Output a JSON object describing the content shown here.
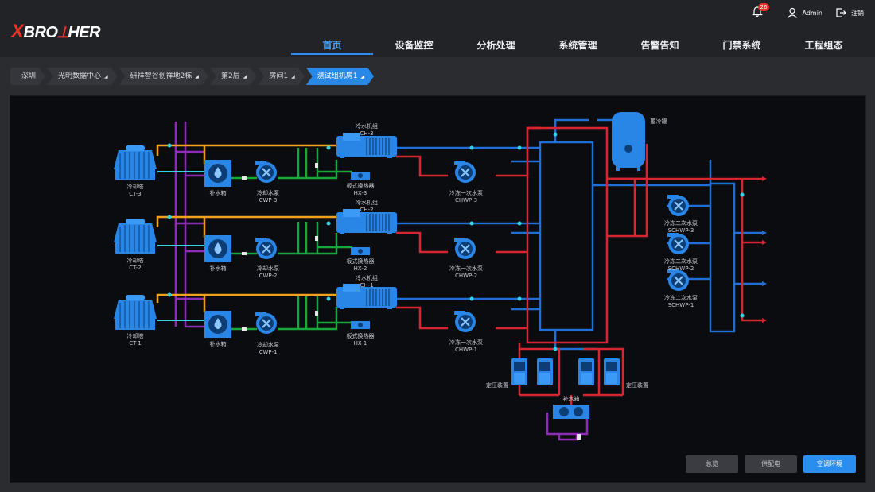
{
  "header": {
    "logo_text": "BRO",
    "logo_x": "X",
    "logo_rest": "HER",
    "nav": [
      "首页",
      "设备监控",
      "分析处理",
      "系统管理",
      "告警告知",
      "门禁系统",
      "工程组态"
    ],
    "notifications": "26",
    "user": "Admin",
    "logout": "注销"
  },
  "breadcrumb": [
    "深圳",
    "光明数据中心",
    "研祥智谷创祥地2栋",
    "第2层",
    "房间1",
    "测试组机房1"
  ],
  "labels": {
    "ct3": [
      "冷却塔",
      "CT-3"
    ],
    "ct2": [
      "冷却塔",
      "CT-2"
    ],
    "ct1": [
      "冷却塔",
      "CT-1"
    ],
    "mk3": [
      "补水箱"
    ],
    "mk2": [
      "补水箱"
    ],
    "mk1": [
      "补水箱"
    ],
    "cwp3": [
      "冷却水泵",
      "CWP-3"
    ],
    "cwp2": [
      "冷却水泵",
      "CWP-2"
    ],
    "cwp1": [
      "冷却水泵",
      "CWP-1"
    ],
    "ch3": [
      "冷水机组",
      "CH-3"
    ],
    "ch2": [
      "冷水机组",
      "CH-2"
    ],
    "ch1": [
      "冷水机组",
      "CH-1"
    ],
    "hx3": [
      "板式换热器",
      "HX-3"
    ],
    "hx2": [
      "板式换热器",
      "HX-2"
    ],
    "hx1": [
      "板式换热器",
      "HX-1"
    ],
    "chwp3": [
      "冷冻一次水泵",
      "CHWP-3"
    ],
    "chwp2": [
      "冷冻一次水泵",
      "CHWP-2"
    ],
    "chwp1": [
      "冷冻一次水泵",
      "CHWP-1"
    ],
    "schwp3": [
      "冷冻二次水泵",
      "SCHWP-3"
    ],
    "schwp2": [
      "冷冻二次水泵",
      "SCHWP-2"
    ],
    "schwp1": [
      "冷冻二次水泵",
      "SCHWP-1"
    ],
    "tank": [
      "蓄冷罐"
    ],
    "press_l": [
      "定压装置"
    ],
    "press_r": [
      "定压装置"
    ],
    "mk_bottom": [
      "补水箱"
    ]
  },
  "buttons": [
    "总览",
    "供配电",
    "空调环境"
  ],
  "colors": {
    "accent": "#2a8ef0",
    "supply": "#1f6fd6",
    "return": "#d7262f",
    "cooling": "#f2a21a",
    "makeup": "#8e2bb8",
    "green": "#18a83a",
    "equipment": "#2a86e6"
  }
}
